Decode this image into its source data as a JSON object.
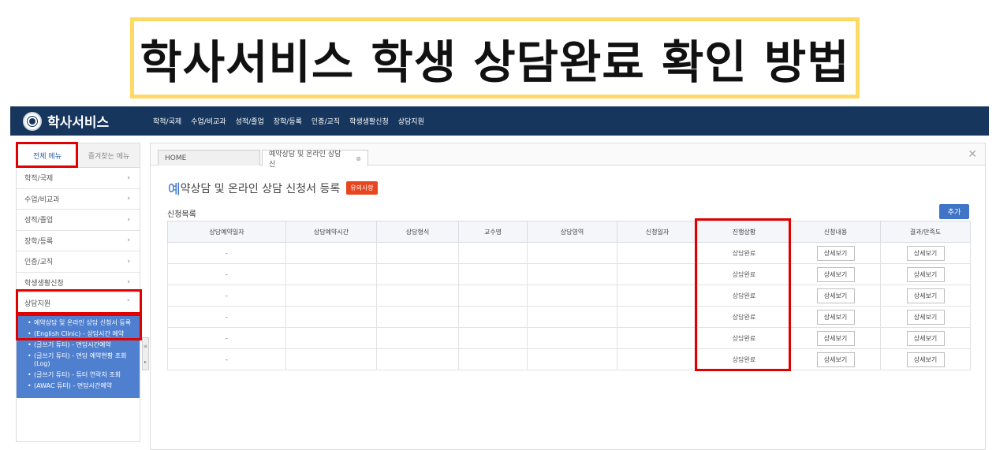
{
  "banner": {
    "title": "학사서비스 학생 상담완료 확인 방법"
  },
  "header": {
    "logo_text": "학사서비스",
    "nav": [
      "학적/국제",
      "수업/비교과",
      "성적/졸업",
      "장학/등록",
      "인증/교직",
      "학생생활신청",
      "상담지원"
    ],
    "color": "#17365d"
  },
  "sidebar": {
    "tabs": [
      "전체 메뉴",
      "즐겨찾는 메뉴"
    ],
    "items": [
      {
        "label": "학적/국제",
        "chev": "›"
      },
      {
        "label": "수업/비교과",
        "chev": "›"
      },
      {
        "label": "성적/졸업",
        "chev": "›"
      },
      {
        "label": "장학/등록",
        "chev": "›"
      },
      {
        "label": "인증/교직",
        "chev": "›"
      },
      {
        "label": "학생생활신청",
        "chev": "›"
      },
      {
        "label": "상담지원",
        "chev": "˅"
      }
    ],
    "sub_items": [
      "예약상담 및 온라인 상담 신청서 등록",
      "(English Clinic) - 상담시간 예약",
      "(글쓰기 튜터) - 면담시간예약",
      "(글쓰기 튜터) - 면담 예약현황 조회(Log)",
      "(글쓰기 튜터) - 튜터 연락처 조회",
      "(AWAC 튜터) - 면담시간예약"
    ]
  },
  "main": {
    "tabs": {
      "home": "HOME",
      "current": "예약상담 및 온라인 상담 신"
    },
    "title_first": "예",
    "title_rest": "약상담 및 온라인 상담 신청서 등록",
    "notice_badge": "유의사항",
    "section_title": "신청목록",
    "add_label": "추가",
    "columns": [
      "상담예약일자",
      "상담예약시간",
      "상담형식",
      "교수명",
      "상담영역",
      "신청일자",
      "진행상황",
      "신청내용",
      "결과/만족도"
    ],
    "rows": [
      {
        "date": "-",
        "status": "상담완료",
        "detail": "상세보기",
        "result": "상세보기"
      },
      {
        "date": "-",
        "status": "상담완료",
        "detail": "상세보기",
        "result": "상세보기"
      },
      {
        "date": "-",
        "status": "상담완료",
        "detail": "상세보기",
        "result": "상세보기"
      },
      {
        "date": "-",
        "status": "상담완료",
        "detail": "상세보기",
        "result": "상세보기"
      },
      {
        "date": "-",
        "status": "상담완료",
        "detail": "상세보기",
        "result": "상세보기"
      },
      {
        "date": "-",
        "status": "상담완료",
        "detail": "상세보기",
        "result": "상세보기"
      }
    ]
  },
  "colors": {
    "highlight": "#e00000",
    "accent": "#3f74c6",
    "submenu_bg": "#4f7fcf",
    "banner_border": "#ffd966"
  }
}
